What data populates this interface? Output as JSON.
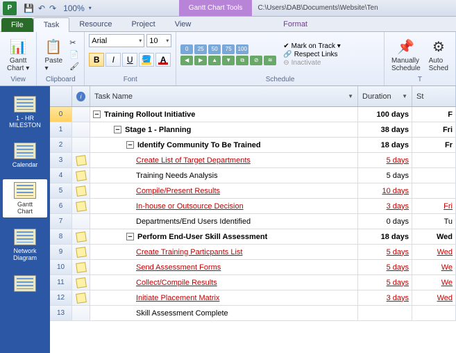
{
  "titlebar": {
    "app_letter": "P",
    "zoom": "100%",
    "context_title": "Gantt Chart Tools",
    "file_path": "C:\\Users\\DAB\\Documents\\Website\\Ten"
  },
  "tabs": {
    "file": "File",
    "task": "Task",
    "resource": "Resource",
    "project": "Project",
    "view": "View",
    "format": "Format"
  },
  "ribbon": {
    "view": {
      "label": "View",
      "gantt_chart": "Gantt\nChart ▾"
    },
    "clipboard": {
      "label": "Clipboard",
      "paste": "Paste\n▾"
    },
    "font": {
      "label": "Font",
      "family": "Arial",
      "size": "10",
      "bold": "B",
      "italic": "I",
      "underline": "U"
    },
    "schedule": {
      "label": "Schedule",
      "mark_on_track": "Mark on Track ▾",
      "respect_links": "Respect Links",
      "inactivate": "Inactivate"
    },
    "tasks_grp": {
      "label": "T",
      "manually": "Manually\nSchedule",
      "auto": "Auto\nSched"
    }
  },
  "viewbar": {
    "milestones": "1 - HR\nMILESTON",
    "calendar": "Calendar",
    "gantt": "Gantt\nChart",
    "network": "Network\nDiagram"
  },
  "columns": {
    "task_name": "Task Name",
    "duration": "Duration",
    "start": "St"
  },
  "rows": [
    {
      "idx": "0",
      "indent": 0,
      "summary": true,
      "note": false,
      "name": "Training Rollout Initiative",
      "dur": "100 days",
      "st": "F",
      "link": false
    },
    {
      "idx": "1",
      "indent": 1,
      "summary": true,
      "note": false,
      "name": "Stage 1 - Planning",
      "dur": "38 days",
      "st": "Fri",
      "link": false
    },
    {
      "idx": "2",
      "indent": 2,
      "summary": true,
      "note": false,
      "name": "Identify Community To Be Trained",
      "dur": "18 days",
      "st": "Fr",
      "link": false
    },
    {
      "idx": "3",
      "indent": 3,
      "summary": false,
      "note": true,
      "name": "Create List of Target Departments",
      "dur": "5 days",
      "st": "",
      "link": true
    },
    {
      "idx": "4",
      "indent": 3,
      "summary": false,
      "note": true,
      "name": "Training Needs Analysis",
      "dur": "5 days",
      "st": "",
      "link": false
    },
    {
      "idx": "5",
      "indent": 3,
      "summary": false,
      "note": true,
      "name": "Compile/Present Results",
      "dur": "10 days",
      "st": "",
      "link": true
    },
    {
      "idx": "6",
      "indent": 3,
      "summary": false,
      "note": true,
      "name": "In-house or Outsource Decision",
      "dur": "3 days",
      "st": "Fri",
      "link": true
    },
    {
      "idx": "7",
      "indent": 3,
      "summary": false,
      "note": false,
      "name": "Departments/End Users Identified",
      "dur": "0 days",
      "st": "Tu",
      "link": false
    },
    {
      "idx": "8",
      "indent": 2,
      "summary": true,
      "note": true,
      "name": "Perform End-User Skill Assessment",
      "dur": "18 days",
      "st": "Wed",
      "link": false
    },
    {
      "idx": "9",
      "indent": 3,
      "summary": false,
      "note": true,
      "name": "Create Training Particpants List",
      "dur": "5 days",
      "st": "Wed",
      "link": true
    },
    {
      "idx": "10",
      "indent": 3,
      "summary": false,
      "note": true,
      "name": "Send Assessment Forms",
      "dur": "5 days",
      "st": "We",
      "link": true
    },
    {
      "idx": "11",
      "indent": 3,
      "summary": false,
      "note": true,
      "name": "Collect/Compile Results",
      "dur": "5 days",
      "st": "We",
      "link": true
    },
    {
      "idx": "12",
      "indent": 3,
      "summary": false,
      "note": true,
      "name": "Initiate Placement Matrix",
      "dur": "3 days",
      "st": "Wed",
      "link": true
    },
    {
      "idx": "13",
      "indent": 3,
      "summary": false,
      "note": false,
      "name": "Skill Assessment Complete",
      "dur": "",
      "st": "",
      "link": false
    }
  ]
}
